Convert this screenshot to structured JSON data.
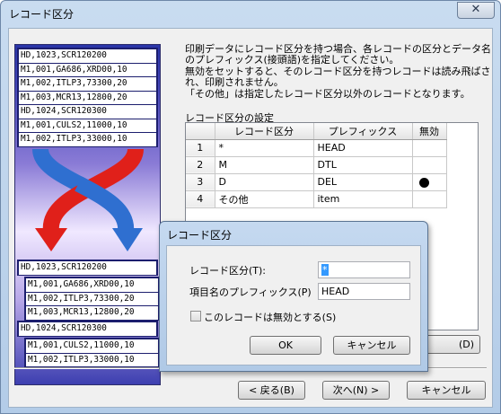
{
  "window": {
    "title": "レコード区分",
    "close_glyph": "✕"
  },
  "illustration": {
    "top_lines": [
      "HD,1023,SCR120200",
      "M1,001,GA686,XRD00,10",
      "M1,002,ITLP3,73300,20",
      "M1,003,MCR13,12800,20",
      "HD,1024,SCR120300",
      "M1,001,CULS2,11000,10",
      "M1,002,ITLP3,33000,10"
    ],
    "bottom_header1": "HD,1023,SCR120200",
    "bottom_group1": [
      "M1,001,GA686,XRD00,10",
      "M1,002,ITLP3,73300,20",
      "M1,003,MCR13,12800,20"
    ],
    "bottom_header2": "HD,1024,SCR120300",
    "bottom_group2": [
      "M1,001,CULS2,11000,10",
      "M1,002,ITLP3,33000,10"
    ]
  },
  "description": {
    "line1": "印刷データにレコード区分を持つ場合、各レコードの区分とデータ名",
    "line2": "のプレフィックス(接頭語)を指定してください。",
    "line3": "無効をセットすると、そのレコード区分を持つレコードは読み飛ばさ",
    "line4": "れ、印刷されません。",
    "line5": "「その他」は指定したレコード区分以外のレコードとなります。"
  },
  "grid": {
    "label": "レコード区分の設定",
    "columns": [
      "",
      "レコード区分",
      "プレフィックス",
      "無効"
    ],
    "rows": [
      {
        "num": "1",
        "kubun": "*",
        "prefix": "HEAD",
        "invalid": false
      },
      {
        "num": "2",
        "kubun": "M",
        "prefix": "DTL",
        "invalid": false
      },
      {
        "num": "3",
        "kubun": "D",
        "prefix": "DEL",
        "invalid": true
      },
      {
        "num": "4",
        "kubun": "その他",
        "prefix": "item",
        "invalid": false
      }
    ]
  },
  "partial_button": {
    "label": "(D)"
  },
  "footer": {
    "back": "< 戻る(B)",
    "next": "次へ(N) >",
    "cancel": "キャンセル"
  },
  "modal": {
    "title": "レコード区分",
    "kubun_label": "レコード区分(T):",
    "kubun_value": "*",
    "prefix_label": "項目名のプレフィックス(P)",
    "prefix_value": "HEAD",
    "checkbox_label": "このレコードは無効とする(S)",
    "checkbox_checked": false,
    "ok": "OK",
    "cancel": "キャンセル"
  },
  "colors": {
    "title_bar": "#b9d1ea",
    "selection": "#3399ff",
    "arrow_red": "#e0201a",
    "arrow_blue": "#2f6fd0"
  }
}
